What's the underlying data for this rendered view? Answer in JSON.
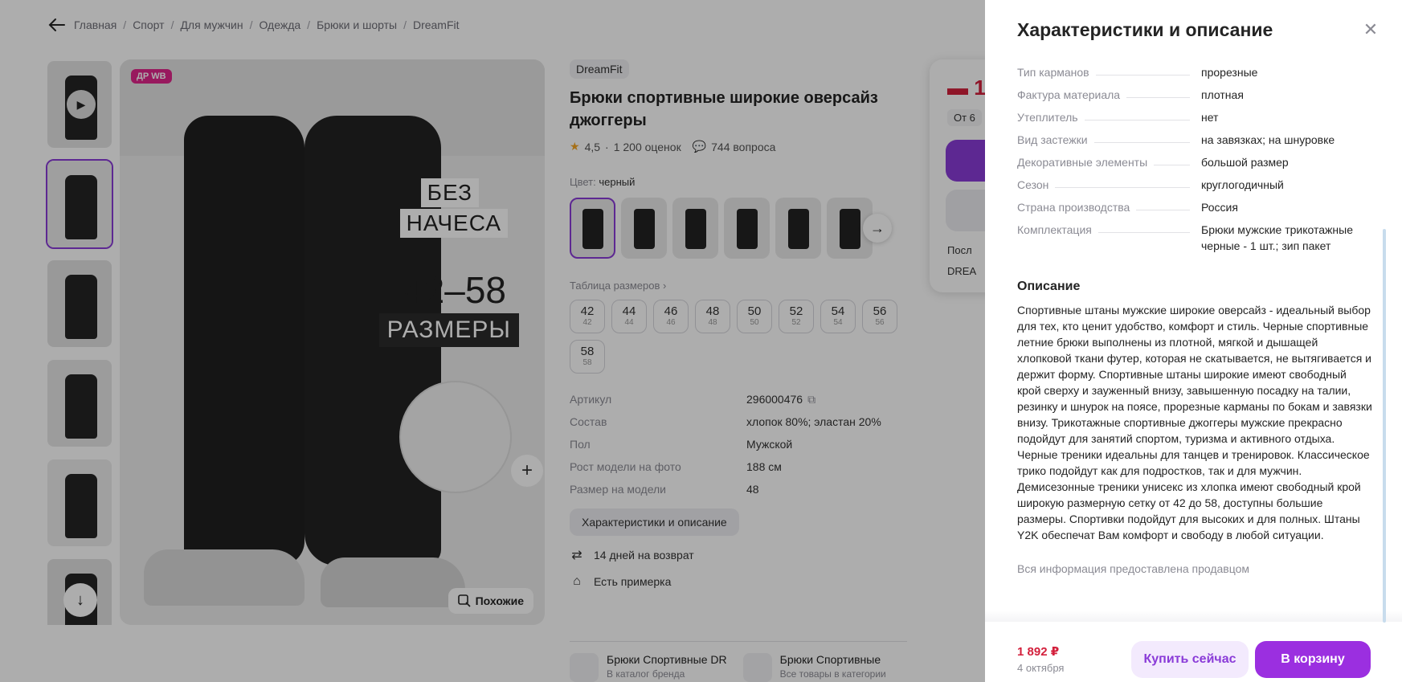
{
  "breadcrumbs": [
    "Главная",
    "Спорт",
    "Для мужчин",
    "Одежда",
    "Брюки и шорты",
    "DreamFit"
  ],
  "gallery": {
    "badge": "ДР WB",
    "promo": [
      "БЕЗ",
      "НАЧЕСА",
      "42–58",
      "РАЗМЕРЫ"
    ],
    "similar_label": "Похожие"
  },
  "product": {
    "brand": "DreamFit",
    "title": "Брюки спортивные широкие оверсайз джоггеры",
    "rating": "4,5",
    "reviews": "1 200 оценок",
    "questions": "744 вопроса",
    "color_label": "Цвет:",
    "color_value": "черный",
    "size_table_label": "Таблица размеров",
    "sizes": [
      {
        "ru": "42",
        "sub": "42"
      },
      {
        "ru": "44",
        "sub": "44"
      },
      {
        "ru": "46",
        "sub": "46"
      },
      {
        "ru": "48",
        "sub": "48"
      },
      {
        "ru": "50",
        "sub": "50"
      },
      {
        "ru": "52",
        "sub": "52"
      },
      {
        "ru": "54",
        "sub": "54"
      },
      {
        "ru": "56",
        "sub": "56"
      },
      {
        "ru": "58",
        "sub": "58"
      }
    ],
    "specs": [
      {
        "k": "Артикул",
        "v": "296000476"
      },
      {
        "k": "Состав",
        "v": "хлопок 80%; эластан 20%"
      },
      {
        "k": "Пол",
        "v": "Мужской"
      },
      {
        "k": "Рост модели на фото",
        "v": "188 см"
      },
      {
        "k": "Размер на модели",
        "v": "48"
      }
    ],
    "char_button": "Характеристики и описание",
    "perks": [
      "14 дней на возврат",
      "Есть примерка"
    ],
    "related": [
      {
        "title": "Брюки Спортивные DR",
        "sub": "В каталог бренда"
      },
      {
        "title": "Брюки Спортивные",
        "sub": "Все товары в категории"
      }
    ]
  },
  "buy_card": {
    "price_partial": "1",
    "chip_partial": "От 6",
    "row1_partial": "Посл",
    "row2_partial": "DREA"
  },
  "drawer": {
    "title": "Характеристики и описание",
    "characteristics": [
      {
        "k": "Тип карманов",
        "v": "прорезные"
      },
      {
        "k": "Фактура материала",
        "v": "плотная"
      },
      {
        "k": "Утеплитель",
        "v": "нет"
      },
      {
        "k": "Вид застежки",
        "v": "на завязках; на шнуровке"
      },
      {
        "k": "Декоративные элементы",
        "v": "большой размер"
      },
      {
        "k": "Сезон",
        "v": "круглогодичный"
      },
      {
        "k": "Страна производства",
        "v": "Россия"
      },
      {
        "k": "Комплектация",
        "v": "Брюки мужские трикотажные черные - 1 шт.; зип пакет"
      }
    ],
    "description_title": "Описание",
    "description": "Спортивные штаны мужские широкие оверсайз - идеальный выбор для тех, кто ценит удобство, комфорт и стиль. Черные спортивные летние брюки выполнены из плотной, мягкой и дышащей хлопковой ткани футер, которая не скатывается, не вытягивается и держит форму. Спортивные штаны широкие имеют свободный крой сверху и зауженный внизу, завышенную посадку на талии, резинку и шнурок на поясе, прорезные карманы по бокам и завязки внизу. Трикотажные спортивные джоггеры мужские прекрасно подойдут для занятий спортом, туризма и активного отдыха. Черные треники идеальны для танцев и тренировок. Классическое трико подойдут как для подростков, так и для мужчин. Демисезонные треники унисекс из хлопка имеют свободный крой широкую размерную сетку от 42 до 58, доступны большие размеры. Спортивки подойдут для высоких и для полных. Штаны Y2K обеспечат Вам комфорт и свободу в любой ситуации.",
    "seller_note": "Вся информация предоставлена продавцом",
    "footer": {
      "price": "1 892 ₽",
      "date": "4 октября",
      "buy_now": "Купить сейчас",
      "to_cart": "В корзину"
    }
  },
  "colors": {
    "accent": "#9b2fe0",
    "price": "#d3203c",
    "badge": "#e0268b"
  }
}
